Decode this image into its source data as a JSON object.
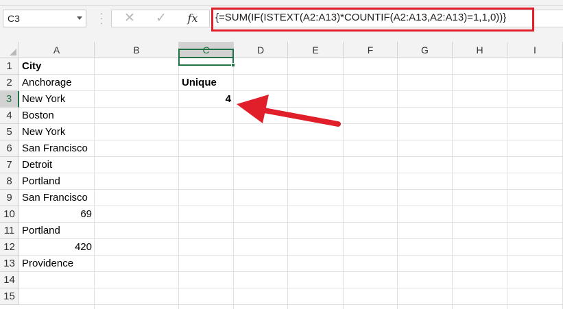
{
  "formula_bar": {
    "name_box": "C3",
    "cancel_symbol": "✕",
    "enter_symbol": "✓",
    "fx_symbol": "fx",
    "formula": "{=SUM(IF(ISTEXT(A2:A13)*COUNTIF(A2:A13,A2:A13)=1,1,0))}"
  },
  "columns": [
    "A",
    "B",
    "C",
    "D",
    "E",
    "F",
    "G",
    "H",
    "I"
  ],
  "selected_column": "C",
  "rows": [
    "1",
    "2",
    "3",
    "4",
    "5",
    "6",
    "7",
    "8",
    "9",
    "10",
    "11",
    "12",
    "13",
    "14",
    "15"
  ],
  "selected_row": "3",
  "cells": {
    "A1": "City",
    "A2": "Anchorage",
    "A3": "New York",
    "A4": "Boston",
    "A5": "New York",
    "A6": "San Francisco",
    "A7": "Detroit",
    "A8": "Portland",
    "A9": "San Francisco",
    "A10": "69",
    "A11": "Portland",
    "A12": "420",
    "A13": "Providence",
    "C2": "Unique",
    "C3": "4"
  },
  "colors": {
    "accent": "#217346",
    "highlight": "#e01f2a"
  }
}
